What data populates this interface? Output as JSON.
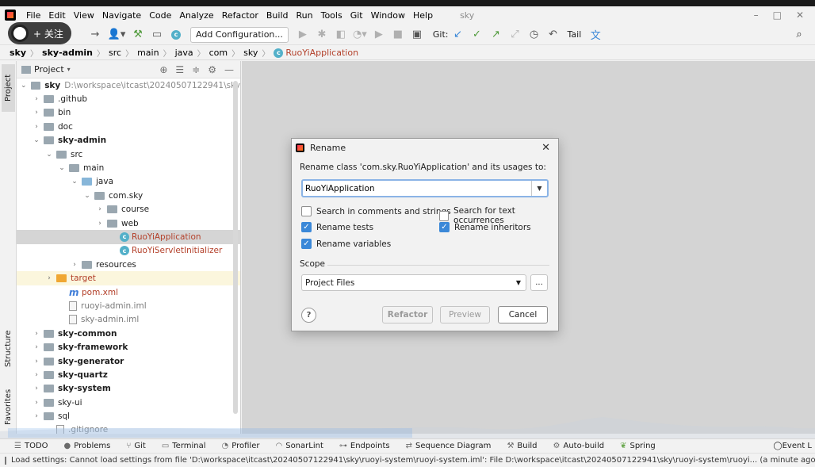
{
  "menu": {
    "items": [
      "File",
      "Edit",
      "View",
      "Navigate",
      "Code",
      "Analyze",
      "Refactor",
      "Build",
      "Run",
      "Tools",
      "Git",
      "Window",
      "Help"
    ],
    "project_name": "sky"
  },
  "overlay": {
    "follow_label": "+ 关注"
  },
  "toolbar": {
    "config_label": "Add Configuration...",
    "git_label": "Git:",
    "tail_label": "Tail"
  },
  "breadcrumb": [
    "sky",
    "sky-admin",
    "src",
    "main",
    "java",
    "com",
    "sky",
    "RuoYiApplication"
  ],
  "left_strip": {
    "project": "Project",
    "structure": "Structure",
    "favorites": "Favorites"
  },
  "project_panel": {
    "title": "Project",
    "tree": [
      {
        "label": "sky",
        "extra": "D:\\workspace\\itcast\\20240507122941\\sky",
        "depth": 0,
        "arrow": "down",
        "icon": "folder",
        "style": "bold"
      },
      {
        "label": ".github",
        "depth": 1,
        "arrow": "right",
        "icon": "folder"
      },
      {
        "label": "bin",
        "depth": 1,
        "arrow": "right",
        "icon": "folder"
      },
      {
        "label": "doc",
        "depth": 1,
        "arrow": "right",
        "icon": "folder"
      },
      {
        "label": "sky-admin",
        "depth": 1,
        "arrow": "down",
        "icon": "folder",
        "style": "bold"
      },
      {
        "label": "src",
        "depth": 2,
        "arrow": "down",
        "icon": "folder"
      },
      {
        "label": "main",
        "depth": 3,
        "arrow": "down",
        "icon": "folder"
      },
      {
        "label": "java",
        "depth": 4,
        "arrow": "down",
        "icon": "folder-blue"
      },
      {
        "label": "com.sky",
        "depth": 5,
        "arrow": "down",
        "icon": "folder"
      },
      {
        "label": "course",
        "depth": 6,
        "arrow": "right",
        "icon": "folder"
      },
      {
        "label": "web",
        "depth": 6,
        "arrow": "right",
        "icon": "folder"
      },
      {
        "label": "RuoYiApplication",
        "depth": 7,
        "arrow": "",
        "icon": "class",
        "style": "red",
        "selected": true
      },
      {
        "label": "RuoYiServletInitializer",
        "depth": 7,
        "arrow": "",
        "icon": "class",
        "style": "red"
      },
      {
        "label": "resources",
        "depth": 4,
        "arrow": "right",
        "icon": "folder"
      },
      {
        "label": "target",
        "depth": 2,
        "arrow": "right",
        "icon": "folder-orange",
        "style": "red",
        "target": true
      },
      {
        "label": "pom.xml",
        "depth": 3,
        "arrow": "",
        "icon": "m",
        "style": "red"
      },
      {
        "label": "ruoyi-admin.iml",
        "depth": 3,
        "arrow": "",
        "icon": "file",
        "style": "gray"
      },
      {
        "label": "sky-admin.iml",
        "depth": 3,
        "arrow": "",
        "icon": "file",
        "style": "gray"
      },
      {
        "label": "sky-common",
        "depth": 1,
        "arrow": "right",
        "icon": "folder",
        "style": "bold"
      },
      {
        "label": "sky-framework",
        "depth": 1,
        "arrow": "right",
        "icon": "folder",
        "style": "bold"
      },
      {
        "label": "sky-generator",
        "depth": 1,
        "arrow": "right",
        "icon": "folder",
        "style": "bold"
      },
      {
        "label": "sky-quartz",
        "depth": 1,
        "arrow": "right",
        "icon": "folder",
        "style": "bold"
      },
      {
        "label": "sky-system",
        "depth": 1,
        "arrow": "right",
        "icon": "folder",
        "style": "bold"
      },
      {
        "label": "sky-ui",
        "depth": 1,
        "arrow": "right",
        "icon": "folder"
      },
      {
        "label": "sql",
        "depth": 1,
        "arrow": "right",
        "icon": "folder"
      },
      {
        "label": ".gitignore",
        "depth": 2,
        "arrow": "",
        "icon": "file",
        "style": "gray"
      }
    ]
  },
  "dialog": {
    "title": "Rename",
    "description": "Rename class 'com.sky.RuoYiApplication' and its usages to:",
    "new_name": "RuoYiApplication",
    "options": [
      {
        "label": "Search in comments and strings",
        "checked": false
      },
      {
        "label": "Search for text occurrences",
        "checked": false
      },
      {
        "label": "Rename tests",
        "checked": true
      },
      {
        "label": "Rename inheritors",
        "checked": true
      },
      {
        "label": "Rename variables",
        "checked": true
      }
    ],
    "scope_label": "Scope",
    "scope_value": "Project Files",
    "more_label": "...",
    "help_label": "?",
    "refactor_label": "Refactor",
    "preview_label": "Preview",
    "cancel_label": "Cancel"
  },
  "bottom_bar": {
    "items": [
      "TODO",
      "Problems",
      "Git",
      "Terminal",
      "Profiler",
      "SonarLint",
      "Endpoints",
      "Sequence Diagram",
      "Build",
      "Auto-build",
      "Spring"
    ],
    "right_item": "Event L"
  },
  "status": {
    "message": "Load settings: Cannot load settings from file 'D:\\workspace\\itcast\\20240507122941\\sky\\ruoyi-system\\ruoyi-system.iml': File D:\\workspace\\itcast\\20240507122941\\sky\\ruoyi-system\\ruoyi... (a minute ago)"
  }
}
